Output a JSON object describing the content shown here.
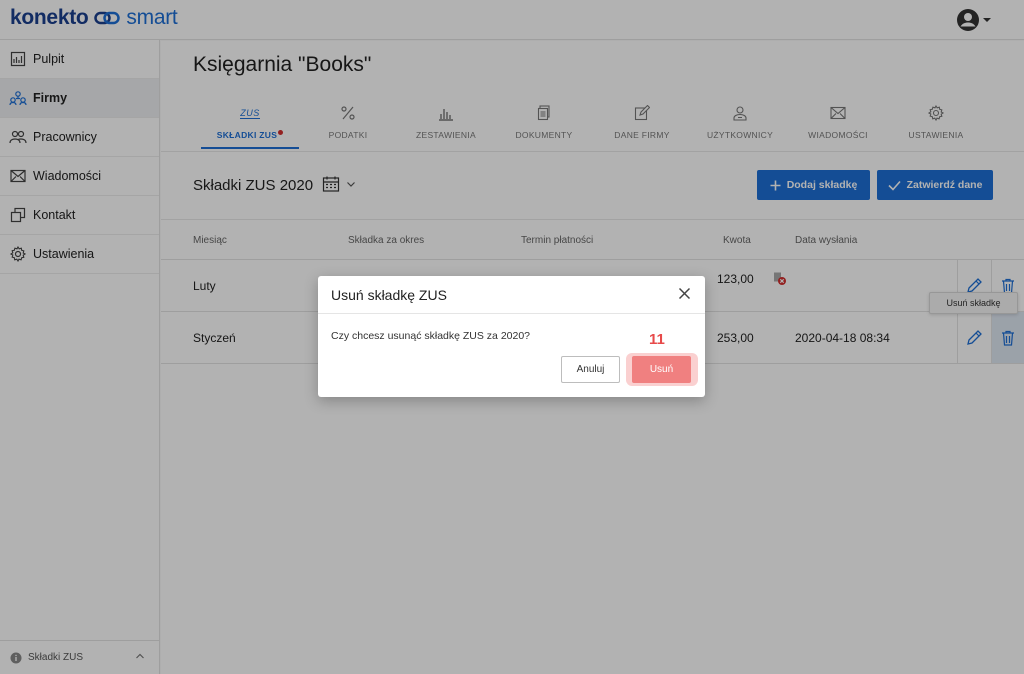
{
  "app": {
    "logo_part1": "konekto",
    "logo_part2": "smart"
  },
  "sidebar": {
    "items": [
      {
        "label": "Pulpit",
        "icon": "dashboard-icon"
      },
      {
        "label": "Firmy",
        "icon": "companies-icon",
        "active": true
      },
      {
        "label": "Pracownicy",
        "icon": "employees-icon"
      },
      {
        "label": "Wiadomości",
        "icon": "mail-icon"
      },
      {
        "label": "Kontakt",
        "icon": "contact-icon"
      },
      {
        "label": "Ustawienia",
        "icon": "settings-icon"
      }
    ],
    "footer": "Składki ZUS"
  },
  "page": {
    "title": "Księgarnia \"Books\""
  },
  "tabs": [
    {
      "label": "SKŁADKI ZUS",
      "icon": "zus-icon",
      "icon_text": "ZUS",
      "active": true
    },
    {
      "label": "PODATKI",
      "icon": "percent-icon"
    },
    {
      "label": "ZESTAWIENIA",
      "icon": "bar-chart-icon"
    },
    {
      "label": "DOKUMENTY",
      "icon": "documents-icon"
    },
    {
      "label": "DANE FIRMY",
      "icon": "edit-icon"
    },
    {
      "label": "UŻYTKOWNICY",
      "icon": "users-icon"
    },
    {
      "label": "WIADOMOŚCI",
      "icon": "envelope-icon"
    },
    {
      "label": "USTAWIENIA",
      "icon": "gear-icon"
    }
  ],
  "section": {
    "title": "Składki ZUS 2020",
    "add_label": "Dodaj składkę",
    "confirm_label": "Zatwierdź dane"
  },
  "table": {
    "headers": [
      "Miesiąc",
      "Składka za okres",
      "Termin płatności",
      "Kwota",
      "Data wysłania"
    ],
    "rows": [
      {
        "month": "Luty",
        "amount": "123,00",
        "sent": ""
      },
      {
        "month": "Styczeń",
        "amount": "253,00",
        "sent": "2020-04-18 08:34"
      }
    ]
  },
  "tooltip": "Usuń składkę",
  "modal": {
    "title": "Usuń składkę ZUS",
    "message": "Czy chcesz usunąć składkę ZUS za 2020?",
    "cancel_label": "Anuluj",
    "delete_label": "Usuń",
    "step": "11"
  },
  "colors": {
    "primary": "#1d6fd6",
    "danger": "#f08080",
    "step": "#e74a4a"
  }
}
